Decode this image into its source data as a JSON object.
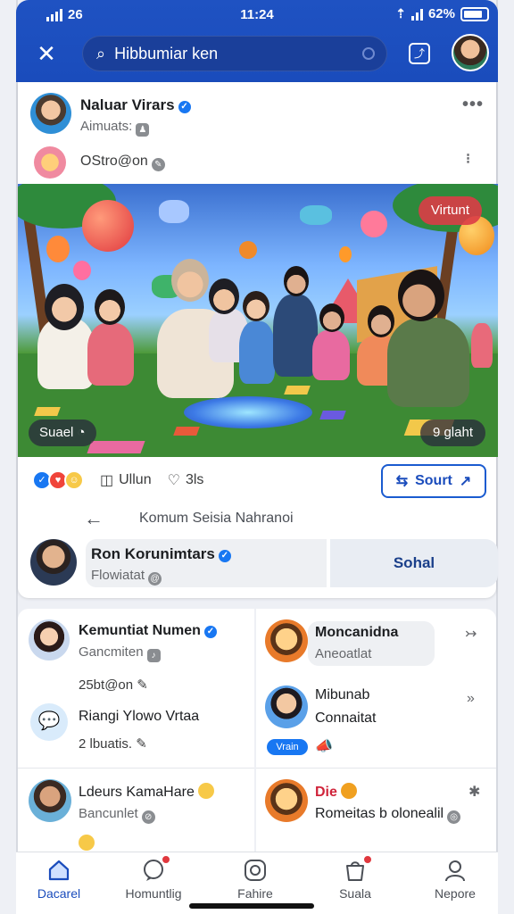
{
  "status_bar": {
    "signal": "26",
    "time": "11:24",
    "battery": "62%"
  },
  "header": {
    "search_text": "Hibbumiar ken"
  },
  "post": {
    "author": "Naluar Virars",
    "subtitle": "Aimuats:",
    "second_line": "OStro@on",
    "scene_badge_top": "Virtunt",
    "scene_badge_left": "Suael",
    "scene_badge_right": "9 glaht",
    "like_label": "Ullun",
    "comment_count": "3ls",
    "sort_label": "Sourt",
    "comment_nav_label": "Komum Seisia Nahranoi",
    "commenter_name": "Ron Korunimtars",
    "commenter_sub": "Flowiatat",
    "solid_button": "Sohal"
  },
  "grid": [
    {
      "name": "Kemuntiat Numen",
      "line2": "Gancmiten",
      "line3": "25bt@on",
      "name2": "Riangi Ylowo Vrtaa",
      "line4": "2 lbuatis."
    },
    {
      "name": "Moncanidna",
      "line2": "Aneoatlat",
      "name2": "Mibunab",
      "line3": "Connaitat",
      "tag": "Vrain"
    },
    {
      "name": "Ldeurs KamaHare",
      "line2": "Bancunlet"
    },
    {
      "name": "Die",
      "line2": "Romeitas b olonealil"
    }
  ],
  "bottom_nav": [
    {
      "label": "Dacarel",
      "icon": "home-icon"
    },
    {
      "label": "Homuntlig",
      "icon": "chat-icon"
    },
    {
      "label": "Fahire",
      "icon": "smiley-icon"
    },
    {
      "label": "Suala",
      "icon": "bag-icon"
    },
    {
      "label": "Nepore",
      "icon": "profile-icon"
    }
  ],
  "colors": {
    "brand": "#1a4cbc",
    "accent": "#1877f2",
    "badge_red": "#e0383e"
  }
}
